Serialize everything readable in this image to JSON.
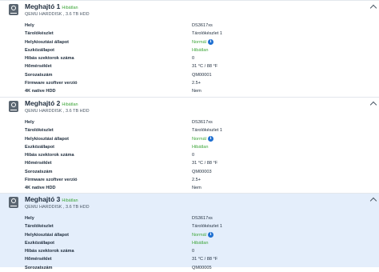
{
  "drives": [
    {
      "title": "Meghajtó 1",
      "status": "Hibátlan",
      "subtitle": "QEMU HARDDISK , 3.6 TB HDD",
      "rows": [
        {
          "label": "Hely",
          "value": "DS3617xs"
        },
        {
          "label": "Tárolókészlet",
          "value": "Tárolókészlet 1"
        },
        {
          "label": "Helykiosztási állapot",
          "value": "Normál"
        },
        {
          "label": "Eszközállapot",
          "value": "Hibátlan"
        },
        {
          "label": "Hibás szektorok száma",
          "value": "0"
        },
        {
          "label": "Hőmérséklet",
          "value": "31 °C / 88 °F"
        },
        {
          "label": "Sorozatszám",
          "value": "QM00001"
        },
        {
          "label": "Firmware szoftver verzió",
          "value": "2.5+"
        },
        {
          "label": "4K native HDD",
          "value": "Nem"
        }
      ]
    },
    {
      "title": "Meghajtó 2",
      "status": "Hibátlan",
      "subtitle": "QEMU HARDDISK , 3.6 TB HDD",
      "rows": [
        {
          "label": "Hely",
          "value": "DS3617xs"
        },
        {
          "label": "Tárolókészlet",
          "value": "Tárolókészlet 1"
        },
        {
          "label": "Helykiosztási állapot",
          "value": "Normál"
        },
        {
          "label": "Eszközállapot",
          "value": "Hibátlan"
        },
        {
          "label": "Hibás szektorok száma",
          "value": "0"
        },
        {
          "label": "Hőmérséklet",
          "value": "31 °C / 88 °F"
        },
        {
          "label": "Sorozatszám",
          "value": "QM00003"
        },
        {
          "label": "Firmware szoftver verzió",
          "value": "2.5+"
        },
        {
          "label": "4K native HDD",
          "value": "Nem"
        }
      ]
    },
    {
      "title": "Meghajtó 3",
      "status": "Hibátlan",
      "subtitle": "QEMU HARDDISK , 3.6 TB HDD",
      "rows": [
        {
          "label": "Hely",
          "value": "DS3617xs"
        },
        {
          "label": "Tárolókészlet",
          "value": "Tárolókészlet 1"
        },
        {
          "label": "Helykiosztási állapot",
          "value": "Normál"
        },
        {
          "label": "Eszközállapot",
          "value": "Hibátlan"
        },
        {
          "label": "Hibás szektorok száma",
          "value": "0"
        },
        {
          "label": "Hőmérséklet",
          "value": "31 °C / 88 °F"
        },
        {
          "label": "Sorozatszám",
          "value": "QM00005"
        }
      ]
    }
  ],
  "colors": {
    "status_green": "#3ea63a",
    "info_blue": "#1e6fd1",
    "selected_bg": "#e4eefb"
  },
  "icons": {
    "drive": "hdd-icon",
    "collapse": "chevron-up-icon",
    "info": "info-icon"
  }
}
